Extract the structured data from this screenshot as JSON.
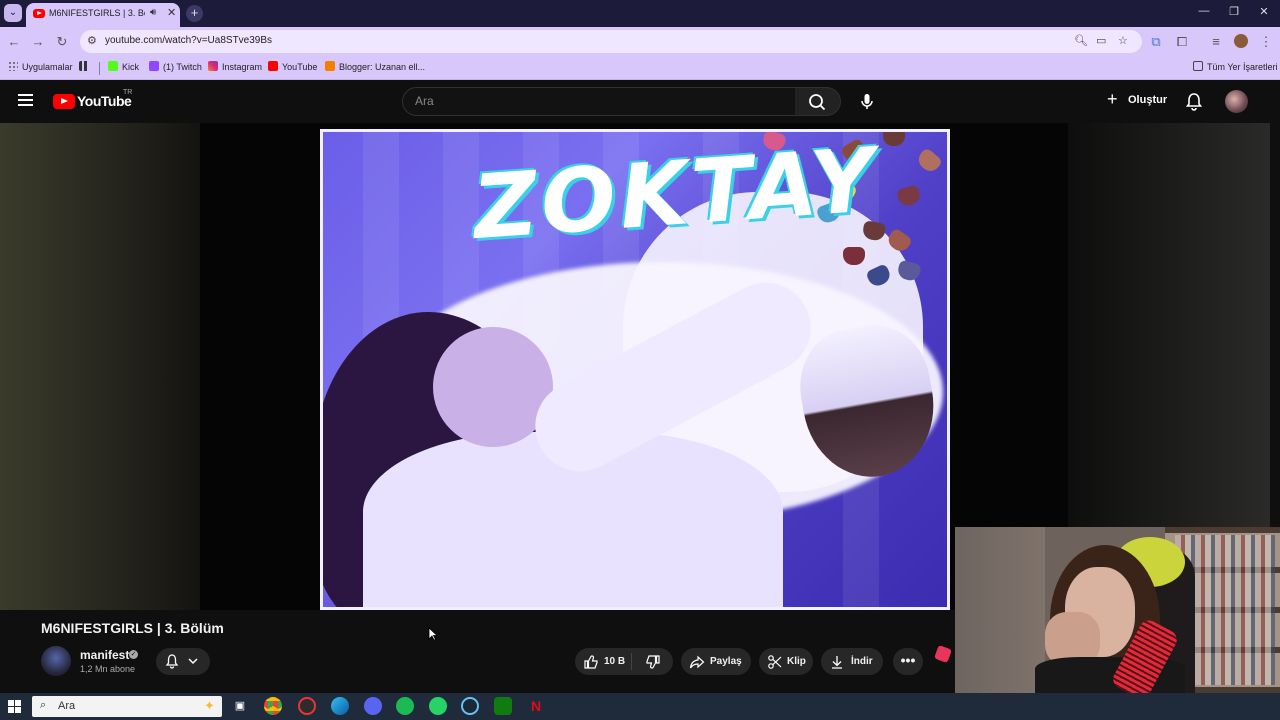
{
  "browser": {
    "tab_title": "M6NIFESTGIRLS | 3. Bölüm",
    "url": "youtube.com/watch?v=Ua8STve39Bs",
    "bookmarks": [
      {
        "label": "Uygulamalar",
        "icon": "grid-icon",
        "color": "#444444"
      },
      {
        "label": "",
        "icon": "apps-icon",
        "color": "#333333"
      },
      {
        "label": "Kick",
        "icon": "kick-icon",
        "color": "#53fc18"
      },
      {
        "label": "(1) Twitch",
        "icon": "twitch-icon",
        "color": "#9146ff"
      },
      {
        "label": "Instagram",
        "icon": "instagram-icon",
        "color": "#e1306c"
      },
      {
        "label": "YouTube",
        "icon": "youtube-icon",
        "color": "#ff0000"
      },
      {
        "label": "Blogger: Uzanan ell...",
        "icon": "blogger-icon",
        "color": "#f57d00"
      }
    ],
    "all_bookmarks_label": "Tüm Yer İşaretleri"
  },
  "youtube": {
    "logo_text": "YouTube",
    "region": "TR",
    "search_placeholder": "Ara",
    "create_label": "Oluştur"
  },
  "video": {
    "overlay_text": "ZOKTAY",
    "title": "M6NIFESTGIRLS | 3. Bölüm",
    "channel_name": "manifest",
    "subscribers": "1,2 Mn abone",
    "likes": "10 B",
    "share_label": "Paylaş",
    "clip_label": "Klip",
    "download_label": "İndir"
  },
  "taskbar": {
    "search_label": "Ara"
  },
  "colors": {
    "browser_accent": "#d8c7fb",
    "youtube_red": "#ff0000",
    "video_purple": "#6b5ee8"
  }
}
